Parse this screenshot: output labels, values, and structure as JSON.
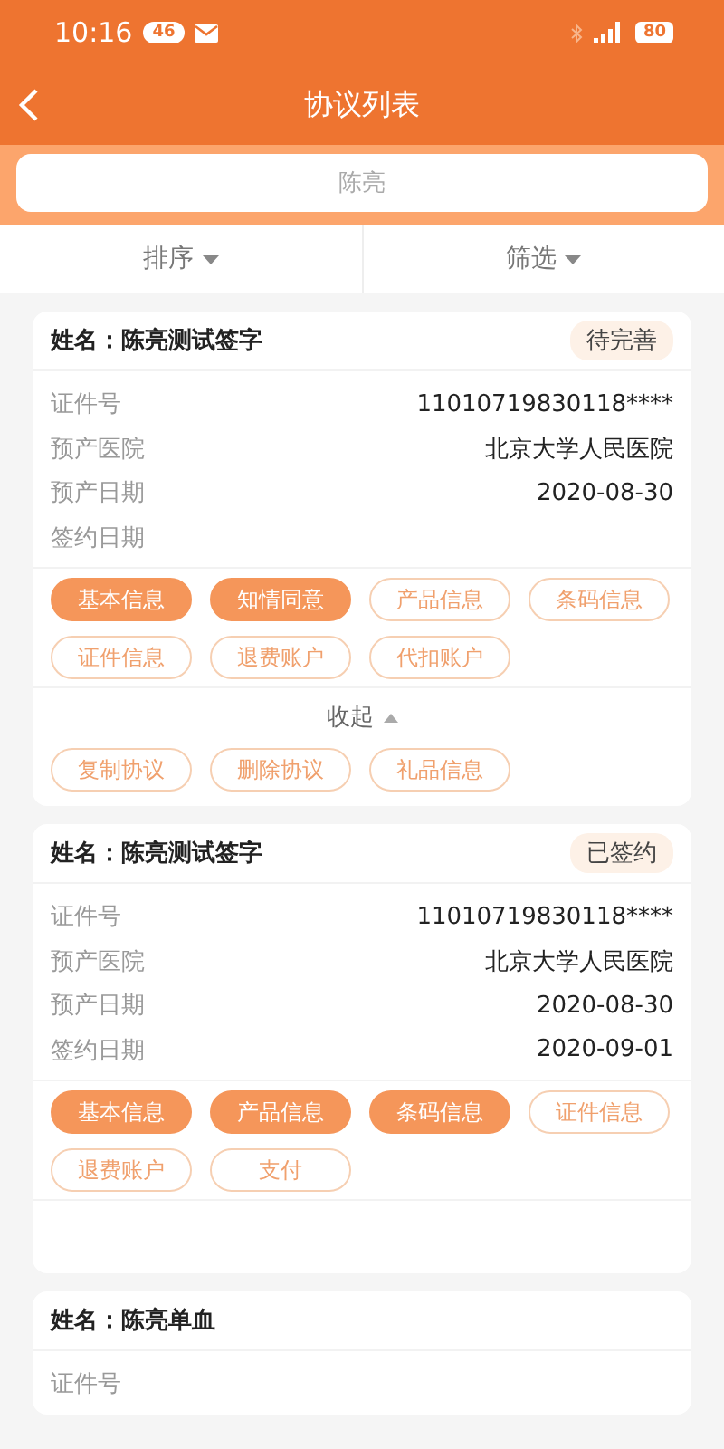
{
  "status_bar": {
    "time": "10:16",
    "network_badge": "46",
    "battery": "80"
  },
  "nav": {
    "title": "协议列表"
  },
  "search": {
    "placeholder": "陈亮"
  },
  "filters": [
    {
      "label": "排序"
    },
    {
      "label": "筛选"
    }
  ],
  "cards": [
    {
      "title": "姓名：陈亮测试签字",
      "status": "待完善",
      "rows": [
        {
          "label": "证件号",
          "value": "11010719830118****"
        },
        {
          "label": "预产医院",
          "value": "北京大学人民医院"
        },
        {
          "label": "预产日期",
          "value": "2020-08-30"
        },
        {
          "label": "签约日期"
        }
      ],
      "chips": [
        {
          "label": "基本信息",
          "selected": true
        },
        {
          "label": "知情同意",
          "selected": true
        },
        {
          "label": "产品信息",
          "selected": false
        },
        {
          "label": "条码信息",
          "selected": false
        },
        {
          "label": "证件信息",
          "selected": false
        },
        {
          "label": "退费账户",
          "selected": false
        },
        {
          "label": "代扣账户",
          "selected": false
        }
      ],
      "collapse": "收起",
      "actions": [
        {
          "label": "复制协议",
          "selected": false
        },
        {
          "label": "删除协议",
          "selected": false
        },
        {
          "label": "礼品信息",
          "selected": false
        }
      ],
      "footer_blank": false
    },
    {
      "title": "姓名：陈亮测试签字",
      "status": "已签约",
      "rows": [
        {
          "label": "证件号",
          "value": "11010719830118****"
        },
        {
          "label": "预产医院",
          "value": "北京大学人民医院"
        },
        {
          "label": "预产日期",
          "value": "2020-08-30"
        },
        {
          "label": "签约日期",
          "value": "2020-09-01"
        }
      ],
      "chips": [
        {
          "label": "基本信息",
          "selected": true
        },
        {
          "label": "产品信息",
          "selected": true
        },
        {
          "label": "条码信息",
          "selected": true
        },
        {
          "label": "证件信息",
          "selected": false
        },
        {
          "label": "退费账户",
          "selected": false
        },
        {
          "label": "支付",
          "selected": false
        }
      ],
      "footer_blank": true
    },
    {
      "title": "姓名：陈亮单血",
      "rows": [
        {
          "label": "证件号"
        }
      ],
      "footer_blank": false
    }
  ]
}
